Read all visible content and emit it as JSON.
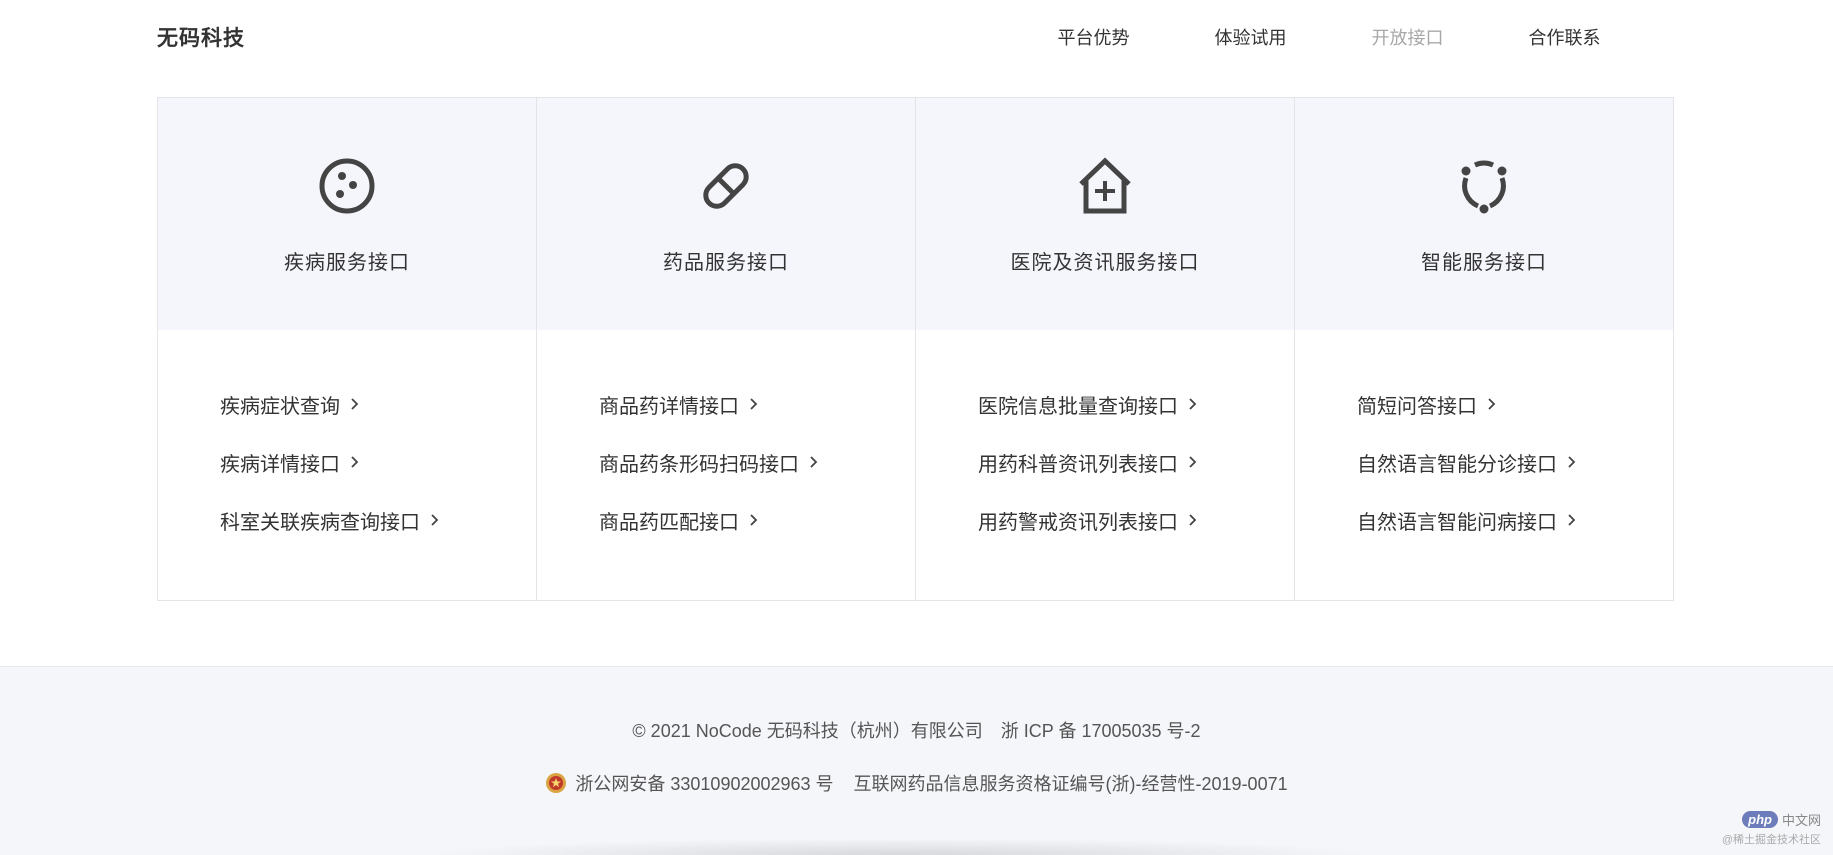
{
  "header": {
    "logo": "无码科技",
    "nav": [
      {
        "label": "平台优势",
        "active": false
      },
      {
        "label": "体验试用",
        "active": false
      },
      {
        "label": "开放接口",
        "active": true
      },
      {
        "label": "合作联系",
        "active": false
      }
    ]
  },
  "columns": [
    {
      "icon": "disease-icon",
      "title": "疾病服务接口",
      "links": [
        "疾病症状查询",
        "疾病详情接口",
        "科室关联疾病查询接口"
      ]
    },
    {
      "icon": "pill-icon",
      "title": "药品服务接口",
      "links": [
        "商品药详情接口",
        "商品药条形码扫码接口",
        "商品药匹配接口"
      ]
    },
    {
      "icon": "hospital-icon",
      "title": "医院及资讯服务接口",
      "links": [
        "医院信息批量查询接口",
        "用药科普资讯列表接口",
        "用药警戒资讯列表接口"
      ]
    },
    {
      "icon": "ai-icon",
      "title": "智能服务接口",
      "links": [
        "简短问答接口",
        "自然语言智能分诊接口",
        "自然语言智能问病接口"
      ]
    }
  ],
  "footer": {
    "copyright": "© 2021 NoCode 无码科技（杭州）有限公司",
    "icp": "浙 ICP 备 17005035 号-2",
    "police": "浙公网安备 33010902002963 号",
    "license": "互联网药品信息服务资格证编号(浙)-经营性-2019-0071"
  },
  "watermark": {
    "logo": "php",
    "cn": "中文网",
    "sub": "@稀土掘金技术社区"
  },
  "colors": {
    "accent_bg": "#f5f6fc",
    "icon": "#444444",
    "nav_active": "#a8a8a8"
  }
}
